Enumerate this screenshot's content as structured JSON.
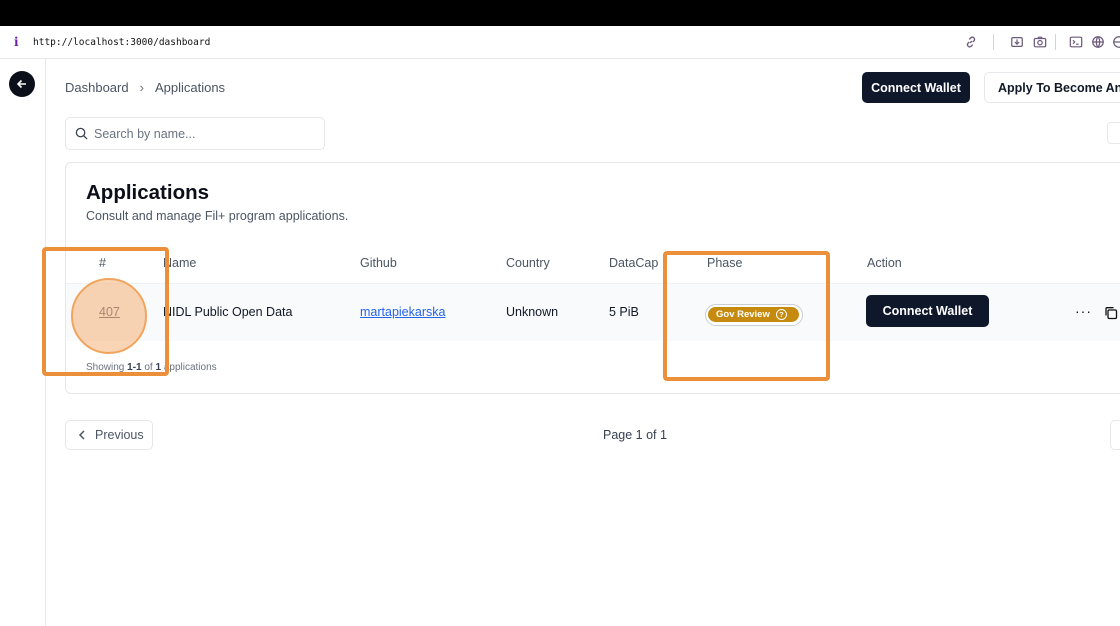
{
  "browser": {
    "url": "http://localhost:3000/dashboard",
    "info_icon": "i"
  },
  "breadcrumb": [
    "Dashboard",
    "Applications"
  ],
  "header": {
    "connect_wallet": "Connect Wallet",
    "apply_notary": "Apply To Become An A"
  },
  "search": {
    "placeholder": "Search by name..."
  },
  "card": {
    "title": "Applications",
    "subtitle": "Consult and manage Fil+ program applications."
  },
  "table": {
    "columns": [
      "#",
      "Name",
      "Github",
      "Country",
      "DataCap",
      "Phase",
      "Action"
    ],
    "rows": [
      {
        "id": "407",
        "name": "NIDL Public Open Data",
        "github": "martapiekarska",
        "country": "Unknown",
        "datacap": "5 PiB",
        "phase": "Gov Review",
        "action": "Connect Wallet"
      }
    ]
  },
  "showing": {
    "prefix": "Showing ",
    "range": "1-1",
    "mid": " of ",
    "total": "1",
    "suffix": " applications"
  },
  "pagination": {
    "previous": "Previous",
    "page": "Page 1 of 1"
  },
  "colors": {
    "accent_dark": "#0f172a",
    "phase_badge": "#c58a0e",
    "highlight": "#ec8f3a",
    "link": "#2563eb"
  },
  "icons": [
    "info-icon",
    "link-icon",
    "download-icon",
    "camera-icon",
    "terminal-icon",
    "globe-icon",
    "back-arrow-icon",
    "search-icon",
    "help-icon",
    "more-icon",
    "copy-icon",
    "chevron-left-icon"
  ]
}
